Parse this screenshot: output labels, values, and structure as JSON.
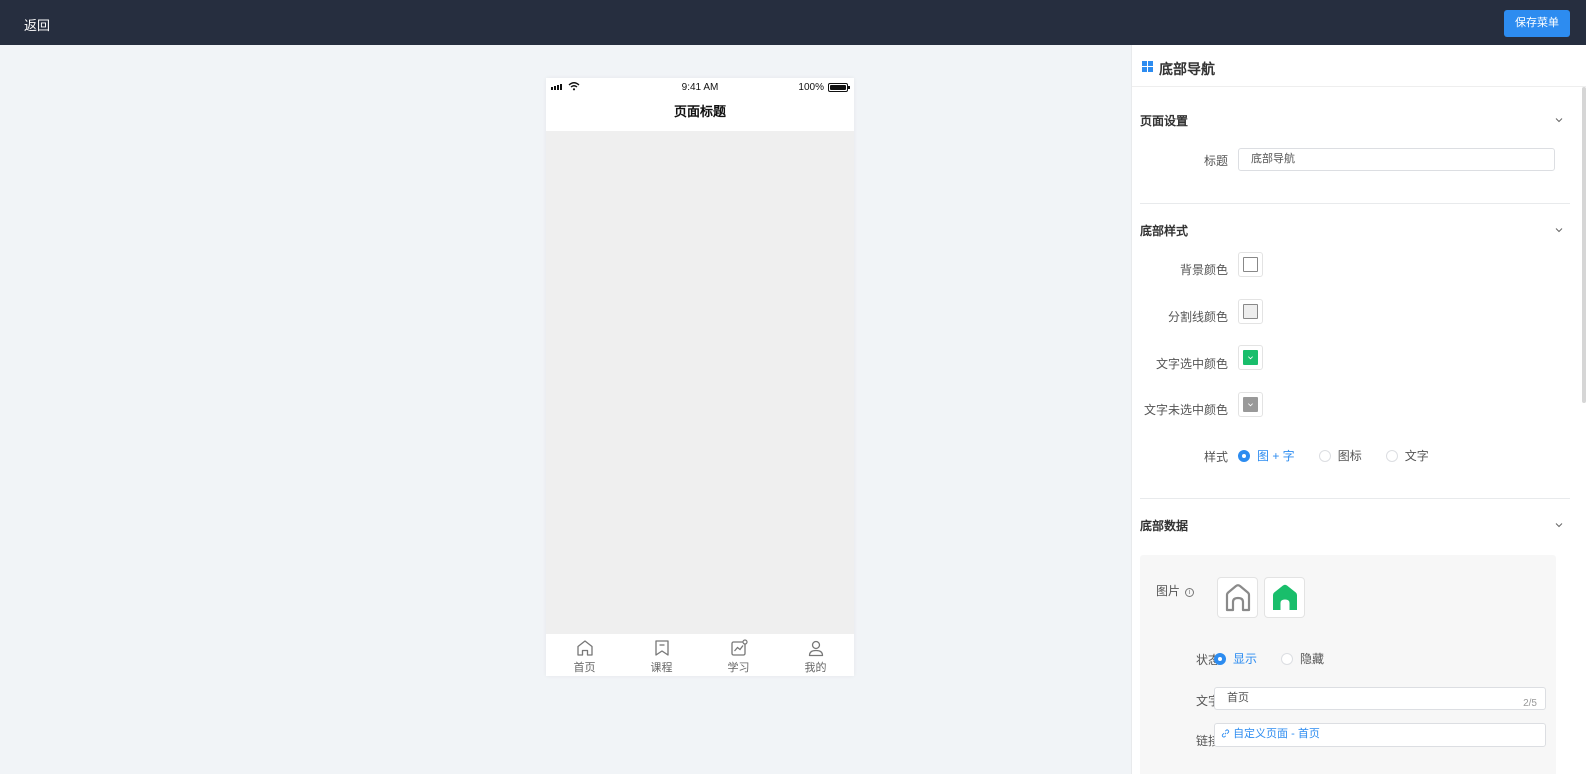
{
  "topbar": {
    "back_label": "返回",
    "save_label": "保存菜单"
  },
  "phone": {
    "status": {
      "time": "9:41 AM",
      "battery": "100%"
    },
    "page_title": "页面标题",
    "tabs": [
      {
        "label": "首页",
        "icon": "home-icon"
      },
      {
        "label": "课程",
        "icon": "bookmark-icon"
      },
      {
        "label": "学习",
        "icon": "chart-icon"
      },
      {
        "label": "我的",
        "icon": "user-icon"
      }
    ]
  },
  "panel": {
    "title": "底部导航",
    "page_settings": {
      "heading": "页面设置",
      "title_label": "标题",
      "title_value": "底部导航"
    },
    "bottom_style": {
      "heading": "底部样式",
      "bg_color_label": "背景颜色",
      "divider_color_label": "分割线颜色",
      "active_text_color_label": "文字选中颜色",
      "inactive_text_color_label": "文字未选中颜色",
      "colors": {
        "background": "#ffffff",
        "divider": "#eeeeee",
        "active_text": "#19be6b",
        "inactive_text": "#999999"
      },
      "style_label": "样式",
      "style_options": [
        "图 + 字",
        "图标",
        "文字"
      ],
      "style_selected": "图 + 字"
    },
    "bottom_data": {
      "heading": "底部数据",
      "image_label": "图片",
      "status_label": "状态",
      "status_options": [
        "显示",
        "隐藏"
      ],
      "status_selected": "显示",
      "text_label": "文字",
      "text_value": "首页",
      "text_counter": "2/5",
      "link_label": "链接",
      "link_value": "自定义页面 - 首页"
    }
  },
  "accent_color": "#2d8cf0",
  "topbar_color": "#262e3f"
}
